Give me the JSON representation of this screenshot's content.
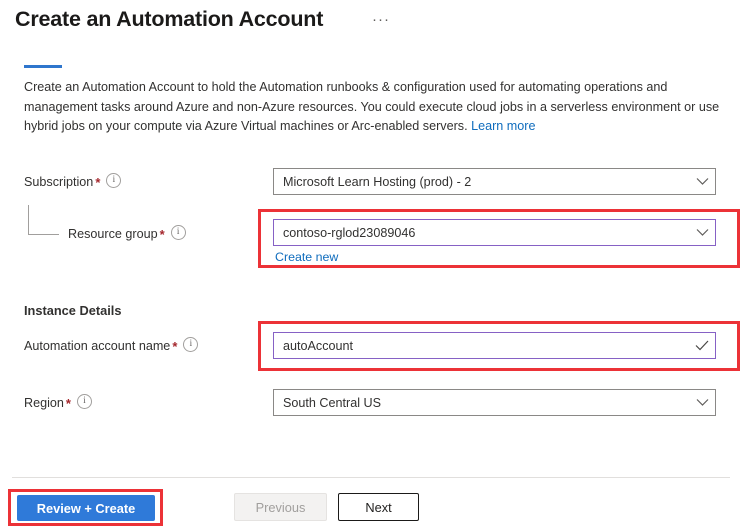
{
  "header": {
    "title": "Create an Automation Account",
    "ellipsis": "···",
    "ellipsis_icon": "more-options-icon"
  },
  "description": {
    "text": "Create an Automation Account to hold the Automation runbooks & configuration used for automating operations and management tasks around Azure and non-Azure resources. You could execute cloud jobs in a serverless environment or use hybrid jobs on your compute via Azure Virtual machines or Arc-enabled servers.",
    "link_label": "Learn more"
  },
  "form": {
    "subscription": {
      "label": "Subscription",
      "required": true,
      "value": "Microsoft Learn Hosting (prod) - 2",
      "icon": "chevron-down-icon",
      "focused": false
    },
    "resource_group": {
      "label": "Resource group",
      "required": true,
      "value": "contoso-rglod23089046",
      "icon": "chevron-down-icon",
      "focused": true,
      "create_new_label": "Create new",
      "highlighted": true
    },
    "instance_details_heading": "Instance Details",
    "automation_account_name": {
      "label": "Automation account name",
      "required": true,
      "value": "autoAccount",
      "icon": "checkmark-icon",
      "focused": true,
      "highlighted": true
    },
    "region": {
      "label": "Region",
      "required": true,
      "value": "South Central US",
      "icon": "chevron-down-icon",
      "focused": false
    }
  },
  "footer": {
    "review_create_label": "Review + Create",
    "previous_label": "Previous",
    "next_label": "Next",
    "review_create_highlighted": true
  },
  "colors": {
    "accent_blue": "#2f7ad9",
    "tab_indicator": "#2f76cd",
    "link_blue": "#0f6cbd",
    "required_red": "#a4262c",
    "annotation_red": "#ec3237",
    "focus_purple": "#8661c5",
    "border_gray": "#8a8886"
  }
}
